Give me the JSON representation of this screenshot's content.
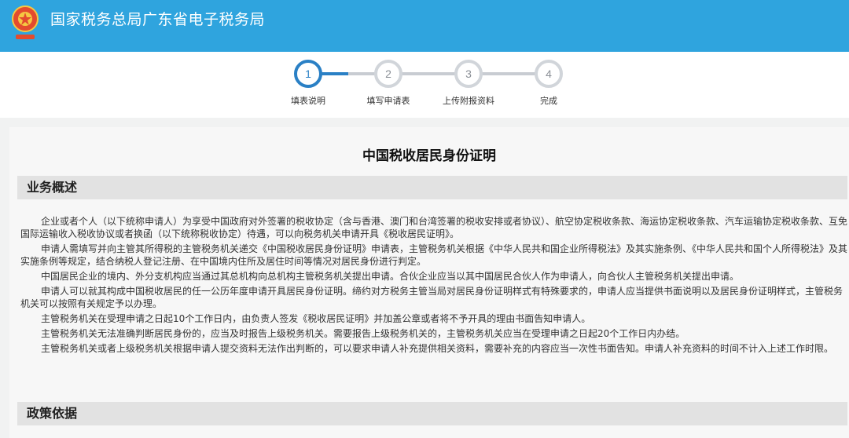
{
  "header": {
    "title": "国家税务总局广东省电子税务局",
    "emblem_icon": "tax-emblem-icon",
    "bg_color": "#2fa4de"
  },
  "steps": [
    {
      "number": "1",
      "label": "填表说明",
      "active": true
    },
    {
      "number": "2",
      "label": "填写申请表",
      "active": false
    },
    {
      "number": "3",
      "label": "上传附报资料",
      "active": false
    },
    {
      "number": "4",
      "label": "完成",
      "active": false
    }
  ],
  "accent_color": "#2a80c5",
  "page": {
    "title": "中国税收居民身份证明"
  },
  "sections": {
    "overview_title": "业务概述",
    "policy_title": "政策依据"
  },
  "overview_paragraphs": [
    "企业或者个人（以下统称申请人）为享受中国政府对外签署的税收协定（含与香港、澳门和台湾签署的税收安排或者协议）、航空协定税收条款、海运协定税收条款、汽车运输协定税收条款、互免国际运输收入税收协议或者换函（以下统称税收协定）待遇，可以向税务机关申请开具《税收居民证明》。",
    "申请人需填写并向主管其所得税的主管税务机关递交《中国税收居民身份证明》申请表，主管税务机关根据《中华人民共和国企业所得税法》及其实施条例、《中华人民共和国个人所得税法》及其实施条例等规定，结合纳税人登记注册、在中国境内住所及居住时间等情况对居民身份进行判定。",
    "中国居民企业的境内、外分支机构应当通过其总机构向总机构主管税务机关提出申请。合伙企业应当以其中国居民合伙人作为申请人，向合伙人主管税务机关提出申请。",
    "申请人可以就其构成中国税收居民的任一公历年度申请开具居民身份证明。缔约对方税务主管当局对居民身份证明样式有特殊要求的，申请人应当提供书面说明以及居民身份证明样式，主管税务机关可以按照有关规定予以办理。",
    "主管税务机关在受理申请之日起10个工作日内，由负责人签发《税收居民证明》并加盖公章或者将不予开具的理由书面告知申请人。",
    "主管税务机关无法准确判断居民身份的，应当及时报告上级税务机关。需要报告上级税务机关的，主管税务机关应当在受理申请之日起20个工作日内办结。",
    "主管税务机关或者上级税务机关根据申请人提交资料无法作出判断的，可以要求申请人补充提供相关资料，需要补充的内容应当一次性书面告知。申请人补充资料的时间不计入上述工作时限。"
  ]
}
